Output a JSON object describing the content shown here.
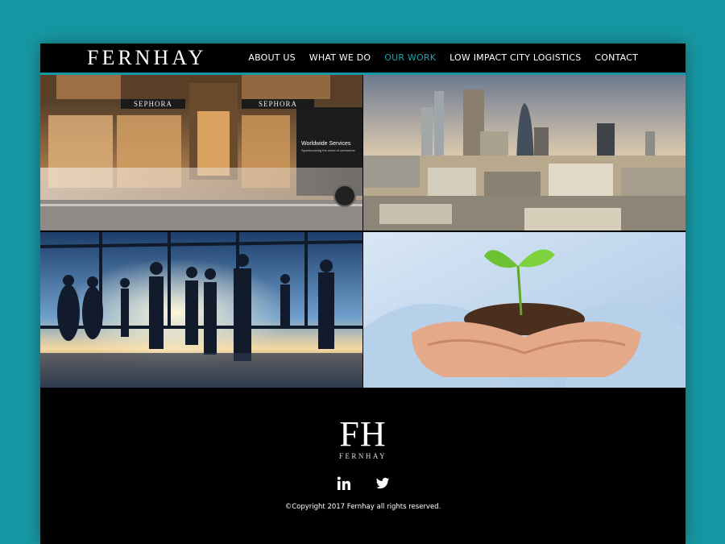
{
  "brand": {
    "name": "FERNHAY",
    "monogram": "FH",
    "monogram_sub": "FERNHAY"
  },
  "nav": {
    "items": [
      {
        "label": "ABOUT US"
      },
      {
        "label": "WHAT WE DO"
      },
      {
        "label": "OUR WORK"
      },
      {
        "label": "LOW IMPACT CITY LOGISTICS"
      },
      {
        "label": "CONTACT"
      }
    ],
    "active": "OUR WORK"
  },
  "tiles": {
    "store_signs": [
      "SEPHORA",
      "SEPHORA"
    ],
    "truck_text": "Worldwide Services",
    "truck_subtext": "Synchronizing the world of commerce"
  },
  "social": {
    "icons": [
      "linkedin-icon",
      "twitter-icon"
    ]
  },
  "footer": {
    "copyright": "©Copyright 2017 Fernhay all rights reserved."
  },
  "colors": {
    "background": "#1797a3",
    "accent": "#1fa3ad",
    "frame": "#000000"
  }
}
